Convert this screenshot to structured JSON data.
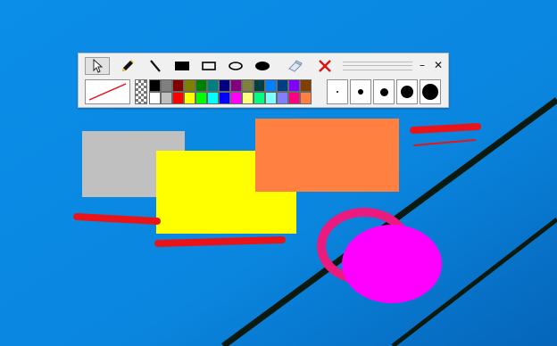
{
  "desktop": {
    "background_color": "#0a8ee8",
    "line_color": "#0b1a10"
  },
  "toolbar": {
    "tools": [
      {
        "name": "select-tool",
        "icon": "cursor-arrow-icon",
        "selected": true
      },
      {
        "name": "pencil-tool",
        "icon": "pencil-icon",
        "selected": false
      },
      {
        "name": "line-tool",
        "icon": "line-icon",
        "selected": false
      },
      {
        "name": "filled-rectangle-tool",
        "icon": "filled-rectangle-icon",
        "selected": false
      },
      {
        "name": "rectangle-tool",
        "icon": "rectangle-outline-icon",
        "selected": false
      },
      {
        "name": "ellipse-tool",
        "icon": "ellipse-outline-icon",
        "selected": false
      },
      {
        "name": "filled-ellipse-tool",
        "icon": "filled-ellipse-icon",
        "selected": false
      },
      {
        "name": "eraser-tool",
        "icon": "eraser-icon",
        "selected": false
      },
      {
        "name": "clear-tool",
        "icon": "red-x-icon",
        "selected": false
      }
    ],
    "window_buttons": {
      "minimize": "–",
      "close": "✕"
    },
    "current_color": "#e8141a",
    "palette_top": [
      "#000000",
      "#808080",
      "#800000",
      "#808000",
      "#008000",
      "#008080",
      "#000080",
      "#800080",
      "#808040",
      "#004040",
      "#0080ff",
      "#004080",
      "#8000ff",
      "#804000"
    ],
    "palette_bottom": [
      "#ffffff",
      "#c0c0c0",
      "#ff0000",
      "#ffff00",
      "#00ff00",
      "#00ffff",
      "#0000ff",
      "#ff00ff",
      "#ffff80",
      "#00ff80",
      "#80ffff",
      "#8080ff",
      "#ff0080",
      "#ff8040"
    ],
    "brush_sizes": [
      2,
      6,
      9,
      14,
      18
    ]
  },
  "canvas": {
    "shapes": [
      {
        "name": "gray-rectangle",
        "color": "#c0c0c0"
      },
      {
        "name": "yellow-rectangle",
        "color": "#ffff00"
      },
      {
        "name": "orange-rectangle",
        "color": "#ff8040"
      },
      {
        "name": "pink-ring",
        "color": "#ea1a7f"
      },
      {
        "name": "magenta-ellipse",
        "color": "#ff00ff"
      },
      {
        "name": "red-strokes",
        "color": "#e8141a"
      }
    ]
  }
}
